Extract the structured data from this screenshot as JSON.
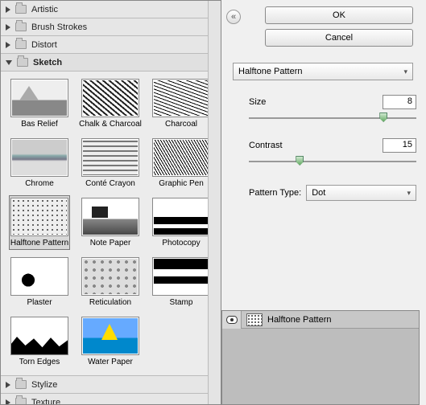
{
  "categories": {
    "artistic": "Artistic",
    "brush_strokes": "Brush Strokes",
    "distort": "Distort",
    "sketch": "Sketch",
    "stylize": "Stylize",
    "texture": "Texture"
  },
  "sketch_filters": [
    {
      "label": "Bas Relief"
    },
    {
      "label": "Chalk & Charcoal"
    },
    {
      "label": "Charcoal"
    },
    {
      "label": "Chrome"
    },
    {
      "label": "Conté Crayon"
    },
    {
      "label": "Graphic Pen"
    },
    {
      "label": "Halftone Pattern"
    },
    {
      "label": "Note Paper"
    },
    {
      "label": "Photocopy"
    },
    {
      "label": "Plaster"
    },
    {
      "label": "Reticulation"
    },
    {
      "label": "Stamp"
    },
    {
      "label": "Torn Edges"
    },
    {
      "label": "Water Paper"
    }
  ],
  "buttons": {
    "ok": "OK",
    "cancel": "Cancel"
  },
  "filter_dropdown": {
    "selected": "Halftone Pattern"
  },
  "params": {
    "size": {
      "label": "Size",
      "value": "8",
      "pos_pct": 78
    },
    "contrast": {
      "label": "Contrast",
      "value": "15",
      "pos_pct": 28
    },
    "pattern_type": {
      "label": "Pattern Type:",
      "selected": "Dot"
    }
  },
  "layers": {
    "row0": "Halftone Pattern"
  },
  "toggle_glyph": "«"
}
